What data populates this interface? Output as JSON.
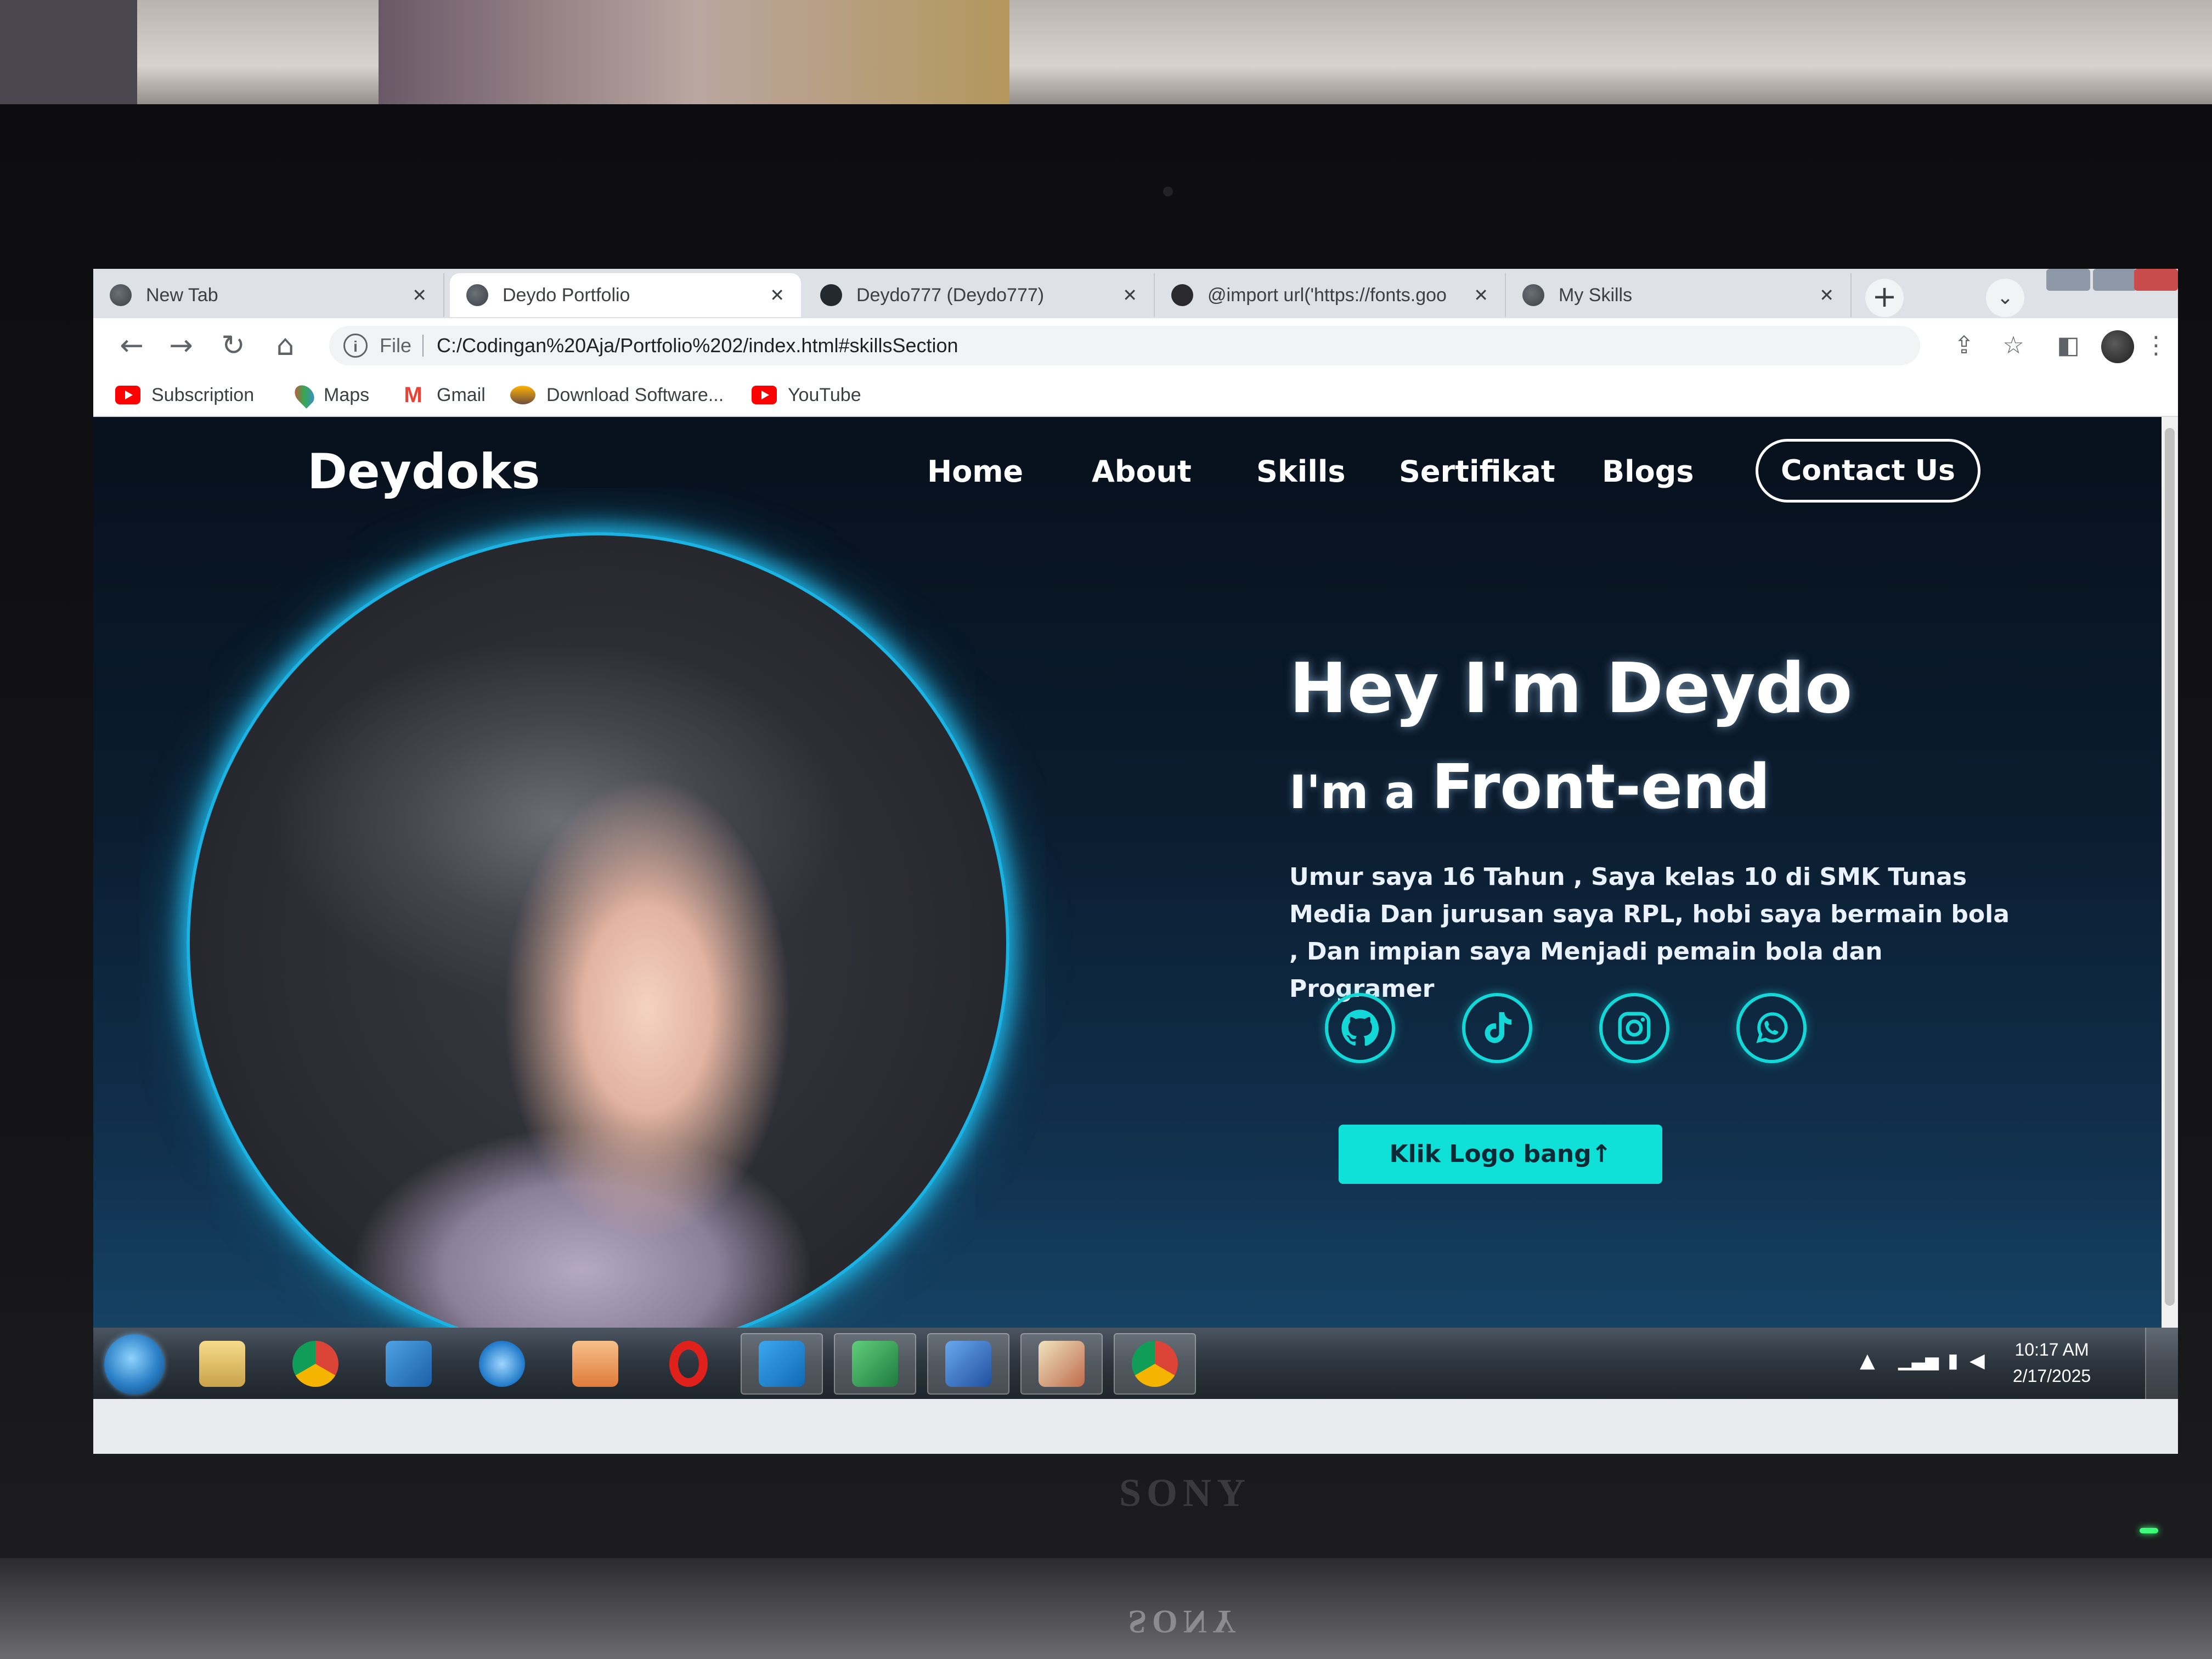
{
  "browser": {
    "tabs": [
      {
        "label": "New Tab",
        "close": "✕",
        "icon": "globe-icon",
        "active": false
      },
      {
        "label": "Deydo Portfolio",
        "close": "✕",
        "icon": "globe-icon",
        "active": true
      },
      {
        "label": "Deydo777 (Deydo777)",
        "close": "✕",
        "icon": "github-icon",
        "active": false
      },
      {
        "label": "@import url('https://fonts.goo",
        "close": "✕",
        "icon": "dark-circle-icon",
        "active": false
      },
      {
        "label": "My Skills",
        "close": "✕",
        "icon": "globe-icon",
        "active": false
      }
    ],
    "new_tab": "+",
    "tab_search": "⌄",
    "nav": {
      "back": "←",
      "forward": "→",
      "reload": "↻",
      "home": "⌂"
    },
    "address": {
      "info": "i",
      "scheme": "File",
      "url": "C:/Codingan%20Aja/Portfolio%202/index.html#skillsSection"
    },
    "toolbar_icons": {
      "share": "⇪",
      "star": "☆",
      "sidepanel": "◧",
      "menu": "⋮"
    },
    "bookmarks": [
      {
        "label": "Subscription",
        "icon": "youtube-icon"
      },
      {
        "label": "Maps",
        "icon": "maps-pin-icon"
      },
      {
        "label": "Gmail",
        "icon": "gmail-icon",
        "glyph": "M"
      },
      {
        "label": "Download Software...",
        "icon": "download-icon"
      },
      {
        "label": "YouTube",
        "icon": "youtube-icon"
      }
    ]
  },
  "page": {
    "logo": "Deydoks",
    "nav": [
      "Home",
      "About",
      "Skills",
      "Sertifikat",
      "Blogs"
    ],
    "contact": "Contact Us",
    "hero": {
      "title": "Hey I'm Deydo",
      "sub_prefix": "I'm a ",
      "sub_role": "Front-end",
      "description": "Umur saya 16 Tahun , Saya kelas 10 di SMK Tunas Media Dan jurusan saya RPL, hobi saya bermain bola , Dan impian saya Menjadi pemain bola dan Programer",
      "social": [
        "github-icon",
        "tiktok-icon",
        "instagram-icon",
        "whatsapp-icon"
      ],
      "cta": "Klik Logo bang↑"
    },
    "colors": {
      "accent": "#10e1d8",
      "glow": "#1ab3e3",
      "background": "#0b1d30"
    }
  },
  "taskbar": {
    "apps": [
      "windows-explorer-icon",
      "chrome-icon",
      "app-icon",
      "internet-explorer-icon",
      "media-player-icon",
      "opera-icon",
      "vscode-icon",
      "excel-icon",
      "word-icon",
      "paint-icon",
      "chrome-icon"
    ],
    "tray": "▲",
    "time": "10:17 AM",
    "date": "2/17/2025"
  },
  "device": {
    "brand": "SONY"
  }
}
